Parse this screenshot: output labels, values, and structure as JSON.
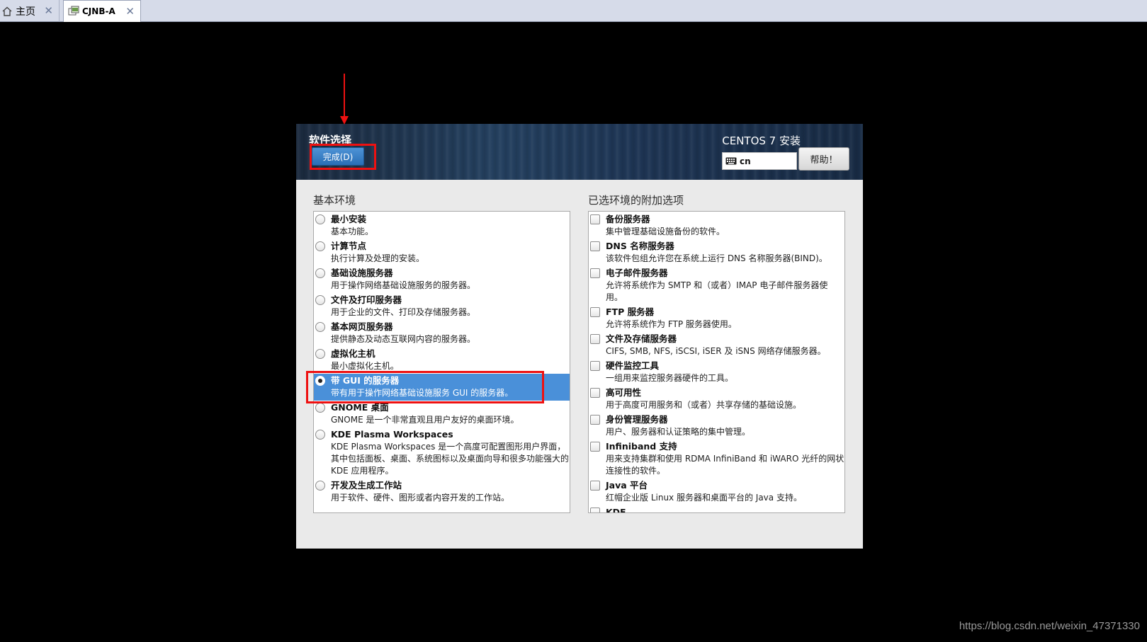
{
  "tabs": [
    {
      "label": "主页",
      "icon": "home-icon",
      "close": "✕"
    },
    {
      "label": "CJNB-A",
      "icon": "vm-icon",
      "close": "✕"
    }
  ],
  "installer": {
    "spoke_title": "软件选择",
    "done_button": "完成(D)",
    "product_title": "CENTOS 7 安装",
    "keyboard_layout": "cn",
    "help_button": "帮助！"
  },
  "base_environment": {
    "label": "基本环境",
    "selected": "带 GUI 的服务器",
    "items": [
      {
        "title": "最小安装",
        "desc": "基本功能。"
      },
      {
        "title": "计算节点",
        "desc": "执行计算及处理的安装。"
      },
      {
        "title": "基础设施服务器",
        "desc": "用于操作网络基础设施服务的服务器。"
      },
      {
        "title": "文件及打印服务器",
        "desc": "用于企业的文件、打印及存储服务器。"
      },
      {
        "title": "基本网页服务器",
        "desc": "提供静态及动态互联网内容的服务器。"
      },
      {
        "title": "虚拟化主机",
        "desc": "最小虚拟化主机。"
      },
      {
        "title": "带 GUI 的服务器",
        "desc": "带有用于操作网络基础设施服务 GUI 的服务器。"
      },
      {
        "title": "GNOME 桌面",
        "desc": "GNOME 是一个非常直观且用户友好的桌面环境。"
      },
      {
        "title": "KDE Plasma Workspaces",
        "desc": "KDE Plasma Workspaces 是一个高度可配置图形用户界面，其中包括面板、桌面、系统图标以及桌面向导和很多功能强大的 KDE 应用程序。"
      },
      {
        "title": "开发及生成工作站",
        "desc": "用于软件、硬件、图形或者内容开发的工作站。"
      }
    ]
  },
  "addons": {
    "label": "已选环境的附加选项",
    "items": [
      {
        "title": "备份服务器",
        "desc": "集中管理基础设施备份的软件。"
      },
      {
        "title": "DNS 名称服务器",
        "desc": "该软件包组允许您在系统上运行 DNS 名称服务器(BIND)。"
      },
      {
        "title": "电子邮件服务器",
        "desc": "允许将系统作为 SMTP 和（或者）IMAP 电子邮件服务器使用。"
      },
      {
        "title": "FTP 服务器",
        "desc": "允许将系统作为 FTP 服务器使用。"
      },
      {
        "title": "文件及存储服务器",
        "desc": "CIFS, SMB, NFS, iSCSI, iSER 及 iSNS 网络存储服务器。"
      },
      {
        "title": "硬件监控工具",
        "desc": "一组用来监控服务器硬件的工具。"
      },
      {
        "title": "高可用性",
        "desc": "用于高度可用服务和（或者）共享存储的基础设施。"
      },
      {
        "title": "身份管理服务器",
        "desc": "用户、服务器和认证策略的集中管理。"
      },
      {
        "title": "Infiniband 支持",
        "desc": "用来支持集群和使用 RDMA InfiniBand 和 iWARO 光纤的网状连接性的软件。"
      },
      {
        "title": "Java 平台",
        "desc": "红帽企业版 Linux 服务器和桌面平台的 Java 支持。"
      },
      {
        "title": "KDE",
        "desc": ""
      }
    ]
  },
  "watermark": "https://blog.csdn.net/weixin_47371330",
  "colors": {
    "annotation": "#ee1111",
    "selected_row": "#4a90d9",
    "done_button": "#3a80c8"
  }
}
